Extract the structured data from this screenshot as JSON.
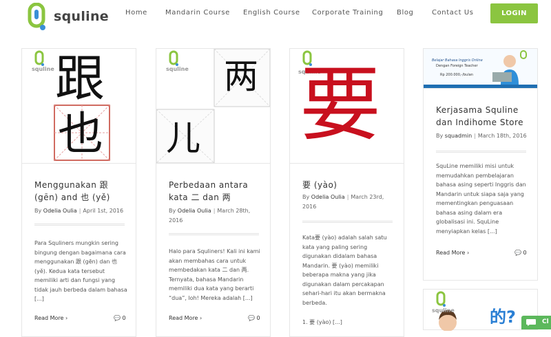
{
  "brand": {
    "name": "squline",
    "color": "#8bc540"
  },
  "nav": {
    "home": "Home",
    "mandarin": "Mandarin Course",
    "english": "English Course",
    "corporate": "Corporate Training",
    "blog": "Blog",
    "contact": "Contact Us",
    "login": "LOGIN"
  },
  "mini_logo_text": "squline",
  "posts": [
    {
      "title": "Menggunakan 跟 (gēn) and 也 (yě)",
      "author": "Odelia Oulia",
      "date": "April 1st, 2016",
      "excerpt": "Para Squliners mungkin sering bingung dengan bagaimana cara menggunakan 跟 (gēn) dan 也 (yě). Kedua kata tersebut memiliki arti dan fungsi yang tidak jauh berbeda dalam bahasa [...]",
      "readmore": "Read More",
      "comments": "0",
      "thumb_chars": [
        "跟",
        "也"
      ]
    },
    {
      "title": "Perbedaan antara kata 二 dan 两",
      "author": "Odelia Oulia",
      "date": "March 28th, 2016",
      "excerpt": "Halo para Squliners! Kali ini kami akan membahas cara untuk membedakan kata 二 dan 两. Ternyata, bahasa Mandarin memiliki dua kata yang berarti “dua”, loh! Mereka adalah [...]",
      "readmore": "Read More",
      "comments": "0",
      "thumb_chars": [
        "两",
        "儿"
      ]
    },
    {
      "title": "要 (yào)",
      "author": "Odelia Oulia",
      "date": "March 23rd, 2016",
      "excerpt": "Kata要 (yào) adalah salah satu kata yang paling sering digunakan didalam bahasa Mandarin. 要 (yào) memiliki beberapa makna yang jika digunakan dalam percakapan sehari-hari itu akan bermakna berbeda.",
      "excerpt2": "1. 要 (yào) [...]",
      "readmore": "Read More",
      "comments": "0",
      "thumb_chars": [
        "要"
      ]
    },
    {
      "title": "Kerjasama Squline dan Indihome Store",
      "author": "squadmin",
      "date": "March 18th, 2016",
      "excerpt": "SquLine memiliki misi untuk memudahkan pembelajaran bahasa asing seperti Inggris dan Mandarin untuk siapa saja yang mementingkan penguasaan bahasa asing dalam era globalisasi ini. SquLine menyiapkan kelas [...]",
      "readmore": "Read More",
      "comments": "0",
      "banner": {
        "line1": "Belajar Bahasa Inggris Online",
        "line2": "Dengan Foreign Teacher",
        "price": "Rp 200.000,-/bulan"
      }
    }
  ],
  "by": "By",
  "next_card": {
    "chars": "的?"
  },
  "chat": {
    "label": "Cl"
  }
}
